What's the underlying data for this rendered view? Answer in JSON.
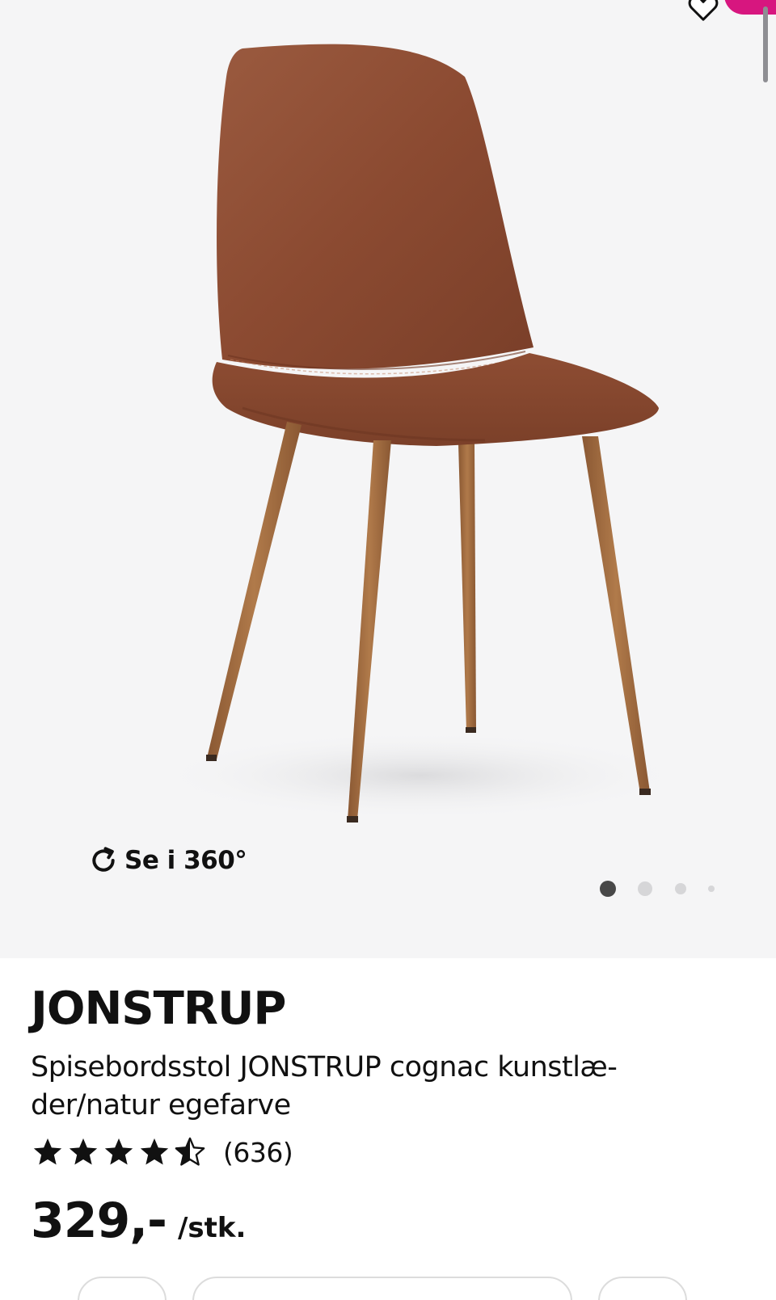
{
  "gallery": {
    "view_360_label": "Se i 360°",
    "image_count": 4,
    "active_image_index": 0
  },
  "product": {
    "name": "JONSTRUP",
    "description": "Spisebordsstol JONSTRUP cognac kunstlæ-\nder/natur egefarve",
    "rating": {
      "stars": 4.5,
      "max_stars": 5,
      "count_label": "(636)"
    },
    "price": {
      "amount": "329,-",
      "unit": "/stk."
    }
  },
  "colors": {
    "gallery_bg": "#f5f5f6",
    "brand_pink": "#d7167f",
    "text": "#111111",
    "leather": "#8a4a33",
    "wood": "#a06a3f"
  },
  "icons": [
    "heart-icon",
    "rotate-360-icon",
    "star-icon",
    "star-half-icon"
  ]
}
